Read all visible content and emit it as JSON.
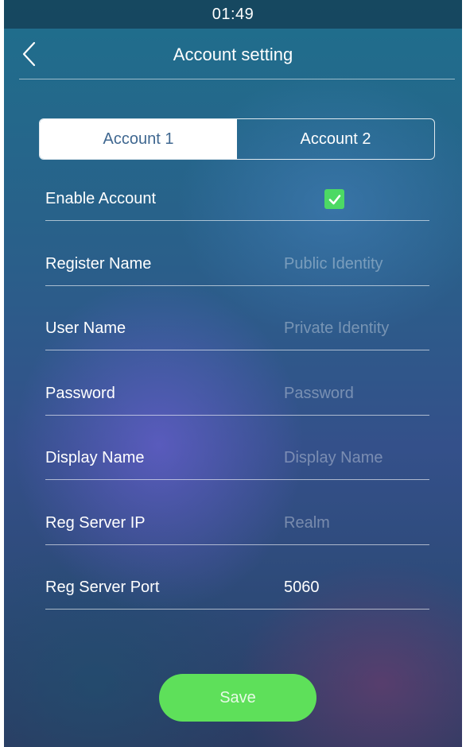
{
  "status_bar": {
    "time": "01:49"
  },
  "header": {
    "title": "Account setting",
    "back_icon": "chevron-left-icon"
  },
  "tabs": [
    {
      "label": "Account 1",
      "active": true
    },
    {
      "label": "Account 2",
      "active": false
    }
  ],
  "form": {
    "enable_account": {
      "label": "Enable Account",
      "checked": true
    },
    "register_name": {
      "label": "Register Name",
      "placeholder": "Public Identity",
      "value": ""
    },
    "user_name": {
      "label": "User Name",
      "placeholder": "Private Identity",
      "value": ""
    },
    "password": {
      "label": "Password",
      "placeholder": "Password",
      "value": ""
    },
    "display_name": {
      "label": "Display Name",
      "placeholder": "Display Name",
      "value": ""
    },
    "reg_server_ip": {
      "label": "Reg Server IP",
      "placeholder": "Realm",
      "value": ""
    },
    "reg_server_port": {
      "label": "Reg Server Port",
      "value": "5060"
    }
  },
  "save_button": {
    "label": "Save"
  },
  "colors": {
    "accent_green": "#5ee05a",
    "checkbox_green": "#4cd964",
    "tab_active_text": "#3f6790"
  }
}
